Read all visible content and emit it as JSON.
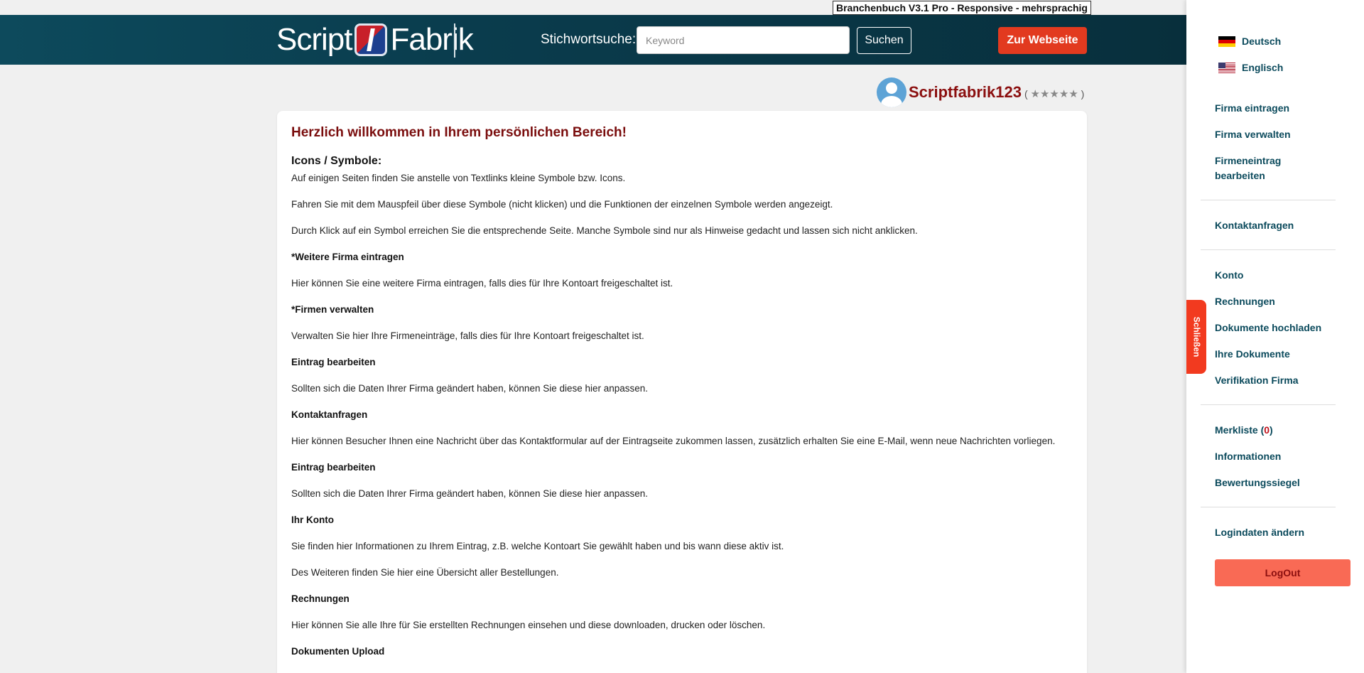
{
  "version_badge": "Branchenbuch V3.1 Pro - Responsive - mehrsprachig",
  "header": {
    "logo_left": "Script",
    "logo_right": "Fabrik",
    "search_label": "Stichwortsuche:",
    "search_placeholder": "Keyword",
    "search_button": "Suchen",
    "website_button": "Zur Webseite"
  },
  "user": {
    "name": "Scriptfabrik123",
    "rating_open": "(",
    "rating_stars": "★★★★★",
    "rating_close": ")"
  },
  "main": {
    "welcome": "Herzlich willkommen in Ihrem persönlichen Bereich!",
    "icons_heading": "Icons / Symbole:",
    "paragraphs": [
      "Auf einigen Seiten finden Sie anstelle von Textlinks kleine Symbole bzw. Icons.",
      "Fahren Sie mit dem Mauspfeil über diese Symbole (nicht klicken) und die Funktionen der einzelnen Symbole werden angezeigt.",
      "Durch Klick auf ein Symbol erreichen Sie die entsprechende Seite. Manche Symbole sind nur als Hinweise gedacht und lassen sich nicht anklicken.",
      "*Weitere Firma eintragen",
      "Hier können Sie eine weitere Firma eintragen, falls dies für Ihre Kontoart freigeschaltet ist.",
      "*Firmen verwalten",
      "Verwalten Sie hier Ihre Firmeneinträge, falls dies für Ihre Kontoart freigeschaltet ist.",
      "Eintrag bearbeiten",
      "Sollten sich die Daten Ihrer Firma geändert haben, können Sie diese hier anpassen.",
      "Kontaktanfragen",
      "Hier können Besucher Ihnen eine Nachricht über das Kontaktformular auf der Eintragseite zukommen lassen, zusätzlich erhalten Sie eine E-Mail, wenn neue Nachrichten vorliegen.",
      "Eintrag bearbeiten",
      "Sollten sich die Daten Ihrer Firma geändert haben, können Sie diese hier anpassen.",
      "Ihr Konto",
      "Sie finden hier Informationen zu Ihrem Eintrag, z.B. welche Kontoart Sie gewählt haben und bis wann diese aktiv ist.",
      "Des Weiteren finden Sie hier eine Übersicht aller Bestellungen.",
      "Rechnungen",
      "Hier können Sie alle Ihre für Sie erstellten Rechnungen einsehen und diese downloaden, drucken oder löschen.",
      "Dokumenten Upload"
    ]
  },
  "sidebar": {
    "languages": [
      "Deutsch",
      "Englisch"
    ],
    "group1": [
      "Firma eintragen",
      "Firma verwalten",
      "Firmeneintrag",
      "bearbeiten"
    ],
    "group2": [
      "Kontaktanfragen"
    ],
    "group3": [
      "Konto",
      "Rechnungen",
      "Dokumente hochladen",
      "Ihre Dokumente",
      "Verifikation Firma"
    ],
    "merkliste_label": "Merkliste (",
    "merkliste_count": "0",
    "merkliste_close": ")",
    "group4": [
      "Informationen",
      "Bewertungssiegel"
    ],
    "login_change": "Logindaten ändern",
    "logout": "LogOut",
    "close_tab": "Schließen"
  },
  "colors": {
    "header_bg": "#0a3c4d",
    "accent_red": "#e23a1f",
    "link": "#0b4a5c",
    "welcome": "#7a0d0d",
    "logout_bg": "#f96a55"
  },
  "icons": [
    "user-avatar-icon",
    "star-icon",
    "german-flag-icon",
    "us-flag-icon"
  ]
}
